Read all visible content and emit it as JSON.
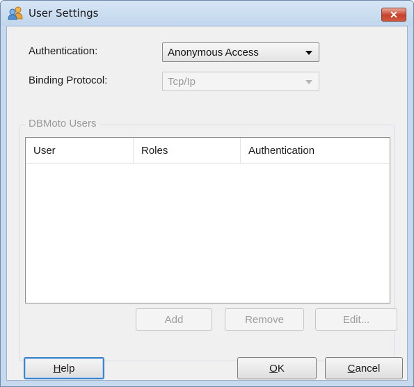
{
  "window": {
    "title": "User Settings",
    "close_label": "✕"
  },
  "form": {
    "authentication_label": "Authentication:",
    "authentication_value": "Anonymous Access",
    "binding_protocol_label": "Binding Protocol:",
    "binding_protocol_value": "Tcp/Ip"
  },
  "users_group": {
    "legend": "DBMoto Users",
    "columns": [
      "User",
      "Roles",
      "Authentication"
    ],
    "rows": []
  },
  "group_buttons": {
    "add": "Add",
    "remove": "Remove",
    "edit": "Edit..."
  },
  "footer": {
    "help": {
      "mnemonic": "H",
      "rest": "elp"
    },
    "ok": {
      "mnemonic": "O",
      "rest": "K"
    },
    "cancel": {
      "mnemonic": "C",
      "rest": "ancel"
    }
  },
  "icons": {
    "title": "users-icon",
    "close": "close-icon",
    "dropdown": "chevron-down-icon"
  },
  "colors": {
    "titlebar": "#c6d9ee",
    "close_button": "#c6402a",
    "dialog_bg": "#f0f0f0",
    "default_button_border": "#3d83c7"
  }
}
